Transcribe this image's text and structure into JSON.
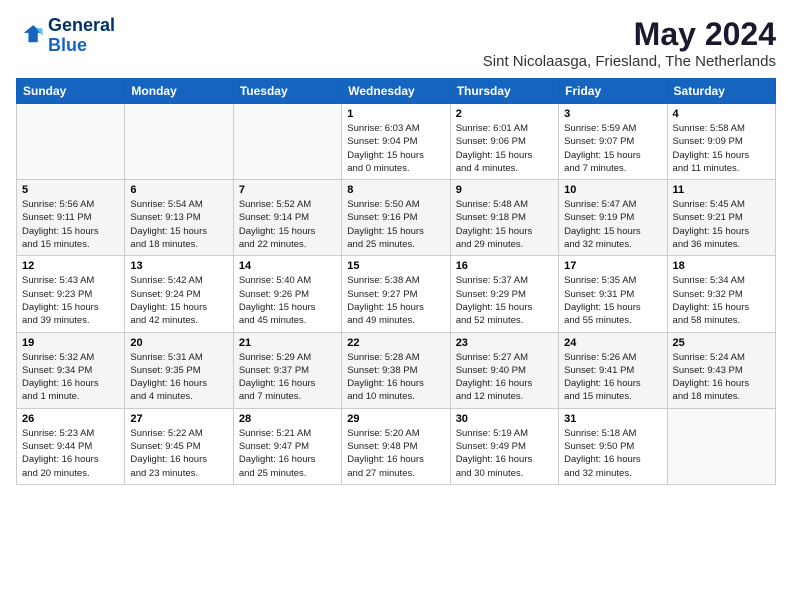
{
  "logo": {
    "line1": "General",
    "line2": "Blue"
  },
  "title": "May 2024",
  "subtitle": "Sint Nicolaasga, Friesland, The Netherlands",
  "days_of_week": [
    "Sunday",
    "Monday",
    "Tuesday",
    "Wednesday",
    "Thursday",
    "Friday",
    "Saturday"
  ],
  "weeks": [
    [
      {
        "day": "",
        "info": ""
      },
      {
        "day": "",
        "info": ""
      },
      {
        "day": "",
        "info": ""
      },
      {
        "day": "1",
        "info": "Sunrise: 6:03 AM\nSunset: 9:04 PM\nDaylight: 15 hours\nand 0 minutes."
      },
      {
        "day": "2",
        "info": "Sunrise: 6:01 AM\nSunset: 9:06 PM\nDaylight: 15 hours\nand 4 minutes."
      },
      {
        "day": "3",
        "info": "Sunrise: 5:59 AM\nSunset: 9:07 PM\nDaylight: 15 hours\nand 7 minutes."
      },
      {
        "day": "4",
        "info": "Sunrise: 5:58 AM\nSunset: 9:09 PM\nDaylight: 15 hours\nand 11 minutes."
      }
    ],
    [
      {
        "day": "5",
        "info": "Sunrise: 5:56 AM\nSunset: 9:11 PM\nDaylight: 15 hours\nand 15 minutes."
      },
      {
        "day": "6",
        "info": "Sunrise: 5:54 AM\nSunset: 9:13 PM\nDaylight: 15 hours\nand 18 minutes."
      },
      {
        "day": "7",
        "info": "Sunrise: 5:52 AM\nSunset: 9:14 PM\nDaylight: 15 hours\nand 22 minutes."
      },
      {
        "day": "8",
        "info": "Sunrise: 5:50 AM\nSunset: 9:16 PM\nDaylight: 15 hours\nand 25 minutes."
      },
      {
        "day": "9",
        "info": "Sunrise: 5:48 AM\nSunset: 9:18 PM\nDaylight: 15 hours\nand 29 minutes."
      },
      {
        "day": "10",
        "info": "Sunrise: 5:47 AM\nSunset: 9:19 PM\nDaylight: 15 hours\nand 32 minutes."
      },
      {
        "day": "11",
        "info": "Sunrise: 5:45 AM\nSunset: 9:21 PM\nDaylight: 15 hours\nand 36 minutes."
      }
    ],
    [
      {
        "day": "12",
        "info": "Sunrise: 5:43 AM\nSunset: 9:23 PM\nDaylight: 15 hours\nand 39 minutes."
      },
      {
        "day": "13",
        "info": "Sunrise: 5:42 AM\nSunset: 9:24 PM\nDaylight: 15 hours\nand 42 minutes."
      },
      {
        "day": "14",
        "info": "Sunrise: 5:40 AM\nSunset: 9:26 PM\nDaylight: 15 hours\nand 45 minutes."
      },
      {
        "day": "15",
        "info": "Sunrise: 5:38 AM\nSunset: 9:27 PM\nDaylight: 15 hours\nand 49 minutes."
      },
      {
        "day": "16",
        "info": "Sunrise: 5:37 AM\nSunset: 9:29 PM\nDaylight: 15 hours\nand 52 minutes."
      },
      {
        "day": "17",
        "info": "Sunrise: 5:35 AM\nSunset: 9:31 PM\nDaylight: 15 hours\nand 55 minutes."
      },
      {
        "day": "18",
        "info": "Sunrise: 5:34 AM\nSunset: 9:32 PM\nDaylight: 15 hours\nand 58 minutes."
      }
    ],
    [
      {
        "day": "19",
        "info": "Sunrise: 5:32 AM\nSunset: 9:34 PM\nDaylight: 16 hours\nand 1 minute."
      },
      {
        "day": "20",
        "info": "Sunrise: 5:31 AM\nSunset: 9:35 PM\nDaylight: 16 hours\nand 4 minutes."
      },
      {
        "day": "21",
        "info": "Sunrise: 5:29 AM\nSunset: 9:37 PM\nDaylight: 16 hours\nand 7 minutes."
      },
      {
        "day": "22",
        "info": "Sunrise: 5:28 AM\nSunset: 9:38 PM\nDaylight: 16 hours\nand 10 minutes."
      },
      {
        "day": "23",
        "info": "Sunrise: 5:27 AM\nSunset: 9:40 PM\nDaylight: 16 hours\nand 12 minutes."
      },
      {
        "day": "24",
        "info": "Sunrise: 5:26 AM\nSunset: 9:41 PM\nDaylight: 16 hours\nand 15 minutes."
      },
      {
        "day": "25",
        "info": "Sunrise: 5:24 AM\nSunset: 9:43 PM\nDaylight: 16 hours\nand 18 minutes."
      }
    ],
    [
      {
        "day": "26",
        "info": "Sunrise: 5:23 AM\nSunset: 9:44 PM\nDaylight: 16 hours\nand 20 minutes."
      },
      {
        "day": "27",
        "info": "Sunrise: 5:22 AM\nSunset: 9:45 PM\nDaylight: 16 hours\nand 23 minutes."
      },
      {
        "day": "28",
        "info": "Sunrise: 5:21 AM\nSunset: 9:47 PM\nDaylight: 16 hours\nand 25 minutes."
      },
      {
        "day": "29",
        "info": "Sunrise: 5:20 AM\nSunset: 9:48 PM\nDaylight: 16 hours\nand 27 minutes."
      },
      {
        "day": "30",
        "info": "Sunrise: 5:19 AM\nSunset: 9:49 PM\nDaylight: 16 hours\nand 30 minutes."
      },
      {
        "day": "31",
        "info": "Sunrise: 5:18 AM\nSunset: 9:50 PM\nDaylight: 16 hours\nand 32 minutes."
      },
      {
        "day": "",
        "info": ""
      }
    ]
  ]
}
